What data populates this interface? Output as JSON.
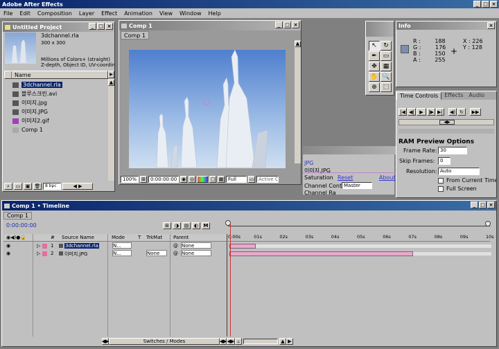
{
  "app": {
    "title": "Adobe After Effects"
  },
  "menu": [
    "File",
    "Edit",
    "Composition",
    "Layer",
    "Effect",
    "Animation",
    "View",
    "Window",
    "Help"
  ],
  "project": {
    "title": "Untitled Project",
    "thumb_name": "3dchannel.rla",
    "thumb_info1": "300 x 300",
    "thumb_info2": "Millions of Colors+ (straight)",
    "thumb_info3": "Z-depth, Object ID, UV-coordin",
    "col_name": "Name",
    "items": [
      {
        "name": "3dchannel.rla",
        "icon": "image-icon"
      },
      {
        "name": "블루스크린.avi",
        "icon": "film-icon"
      },
      {
        "name": "이미지.jpg",
        "icon": "image-icon"
      },
      {
        "name": "이미지.JPG",
        "icon": "image-icon"
      },
      {
        "name": "이미지2.gif",
        "icon": "gif-icon"
      },
      {
        "name": "Comp 1",
        "icon": "comp-icon"
      }
    ],
    "bpc": "8 bpc"
  },
  "comp": {
    "title": "Comp 1",
    "tab": "Comp 1",
    "zoom": "100%",
    "timecode": "0:00:00:00",
    "res": "Full",
    "camera": "Active C"
  },
  "info": {
    "title": "Info",
    "r": "188",
    "g": "176",
    "b": "150",
    "a": "255",
    "x": "226",
    "y": "128"
  },
  "time_controls": {
    "tabs": [
      "Time Controls",
      "Effects",
      "Audio"
    ]
  },
  "ram_preview": {
    "title": "RAM Preview Options",
    "frame_rate_label": "Frame Rate:",
    "frame_rate": "30",
    "skip_label": "Skip Frames:",
    "skip": "0",
    "res_label": "Resolution:",
    "res": "Auto",
    "from_current": "From Current Time",
    "full_screen": "Full Screen"
  },
  "effects_behind": {
    "tab": "JPG",
    "name": "이미지.JPG",
    "saturation": "Saturation",
    "reset": "Reset",
    "about": "About...",
    "channel_control": "Channel Control",
    "master": "Master",
    "channel_range": "Channel Ra"
  },
  "timeline": {
    "title": "Comp 1 • Timeline",
    "tab": "Comp 1",
    "timecode": "0:00:00:00",
    "headers": [
      "#",
      "Source Name",
      "Mode",
      "T",
      "TrkMat",
      "Parent"
    ],
    "ruler": [
      "0:00s",
      "01s",
      "02s",
      "03s",
      "04s",
      "05s",
      "06s",
      "07s",
      "08s",
      "09s",
      "10s"
    ],
    "layers": [
      {
        "num": "1",
        "name": "3dchannel.rla",
        "mode": "N...",
        "trkmat": "",
        "parent": "None",
        "bar_end": 0.1
      },
      {
        "num": "2",
        "name": "이미지.JPG",
        "mode": "N...",
        "trkmat": "None",
        "parent": "None",
        "bar_end": 0.7
      }
    ],
    "switches": "Switches / Modes"
  },
  "colors": {
    "title_active": "#0a246a",
    "panel": "#c0c0c0",
    "clip": "#e9a9c9",
    "sky": "#8fb2dd"
  }
}
